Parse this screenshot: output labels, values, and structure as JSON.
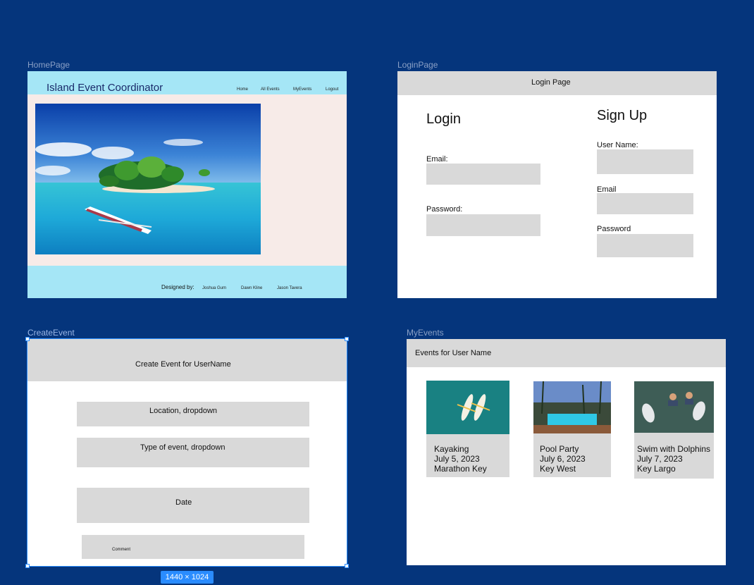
{
  "frames": {
    "home": {
      "label": "HomePage",
      "title": "Island Event Coordinator",
      "nav": [
        "Home",
        "All Events",
        "MyEvents",
        "Logout"
      ],
      "footer": {
        "designed_by": "Designed by:",
        "names": [
          "Joshua Gum",
          "Dawn Kline",
          "Jason Tavera"
        ]
      }
    },
    "login": {
      "label": "LoginPage",
      "header": "Login Page",
      "login_heading": "Login",
      "email_label": "Email:",
      "password_label": "Password:",
      "signup_heading": "Sign Up",
      "username_label": "User Name:",
      "signup_email_label": "Email",
      "signup_password_label": "Password"
    },
    "create": {
      "label": "CreateEvent",
      "header": "Create Event for UserName",
      "location": "Location, dropdown",
      "type": "Type of event, dropdown",
      "date": "Date",
      "comment": "Comment",
      "size_badge": "1440 × 1024"
    },
    "myevents": {
      "label": "MyEvents",
      "header": "Events for User Name",
      "events": [
        {
          "name": "Kayaking",
          "date": "July 5, 2023",
          "place": "Marathon Key"
        },
        {
          "name": "Pool Party",
          "date": "July 6, 2023",
          "place": "Key West"
        },
        {
          "name": "Swim with Dolphins",
          "date": "July 7, 2023",
          "place": "Key Largo"
        }
      ]
    }
  },
  "colors": {
    "canvas": "#05357c",
    "home_header": "#a5e6f6",
    "home_body": "#f7ebe8",
    "placeholder_gray": "#d9d9d9",
    "selection": "#2a8cff"
  }
}
